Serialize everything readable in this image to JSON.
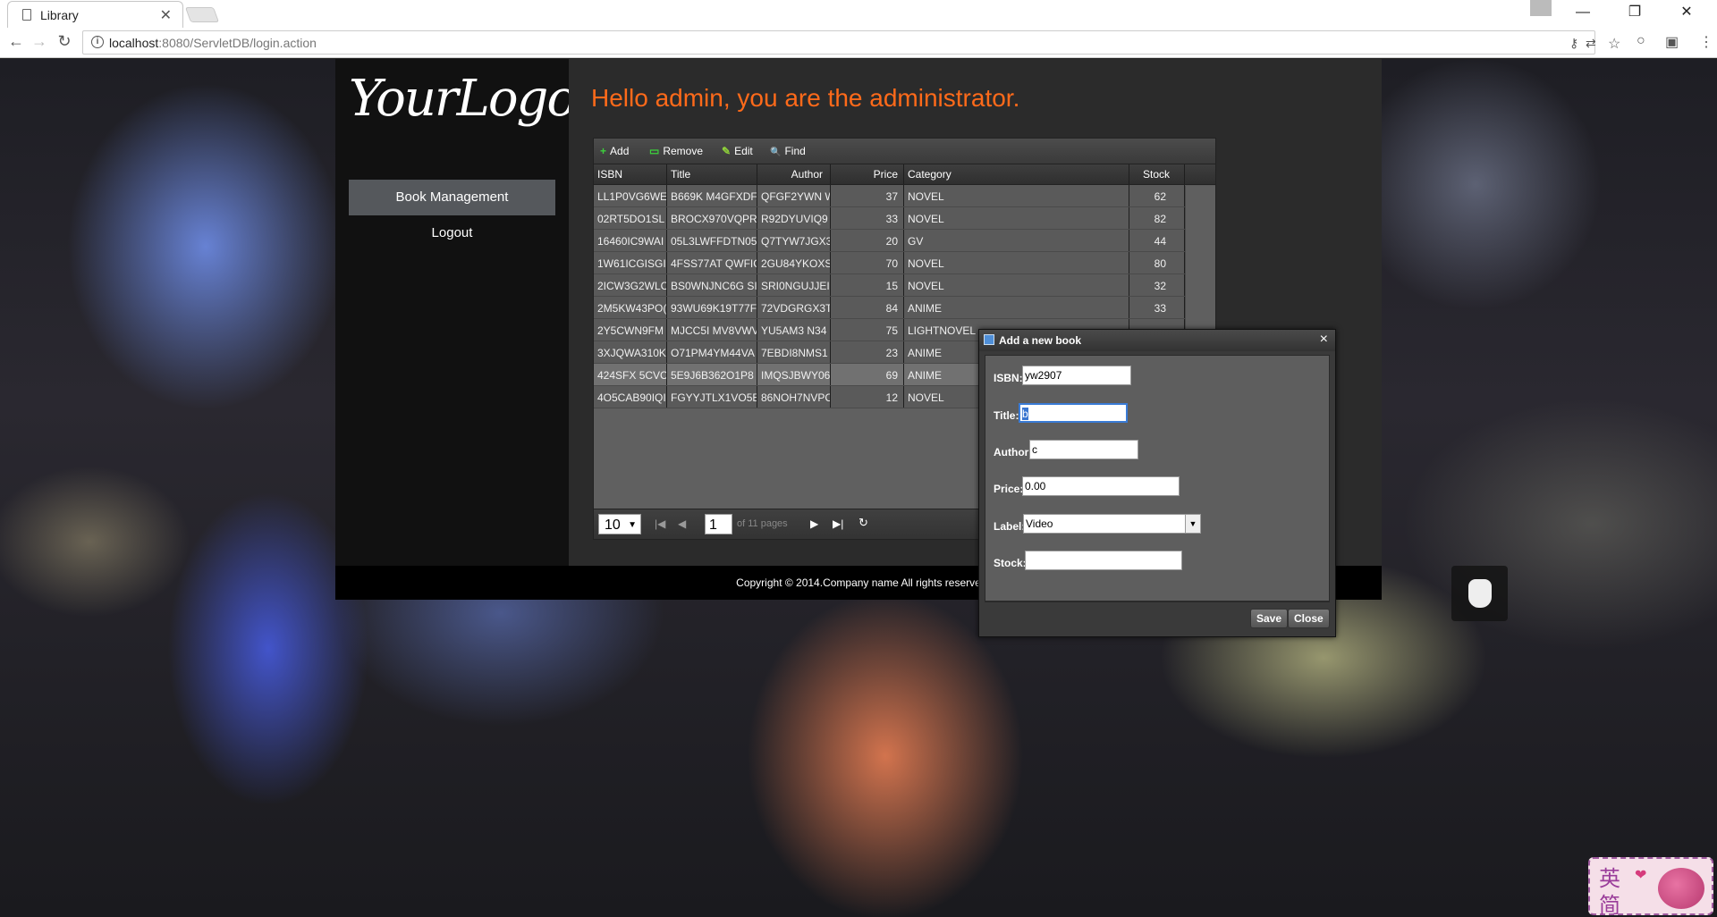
{
  "browser": {
    "tab_title": "Library",
    "tab_close": "✕",
    "url_host": "localhost",
    "url_rest": ":8080/ServletDB/login.action",
    "win_minimize": "—",
    "win_restore": "❐",
    "win_close": "✕",
    "back": "←",
    "forward": "→",
    "reload": "↻",
    "info_icon": "i",
    "key_icon": "⚷",
    "translate_icon": "⇄",
    "star_icon": "☆",
    "ext1_icon": "○",
    "ext2_icon": "▣",
    "menu_icon": "⋮"
  },
  "sidebar": {
    "logo": "YourLogo",
    "items": [
      {
        "label": "Book Management",
        "active": true
      },
      {
        "label": "Logout",
        "active": false
      }
    ]
  },
  "main": {
    "greeting": "Hello admin, you are the administrator."
  },
  "grid": {
    "toolbar": [
      {
        "label": "Add",
        "icon": "plus-icon",
        "glyph": "+",
        "color": "#3cd03c"
      },
      {
        "label": "Remove",
        "icon": "minus-icon",
        "glyph": "▭",
        "color": "#3cd03c"
      },
      {
        "label": "Edit",
        "icon": "pencil-icon",
        "glyph": "✎",
        "color": "#8fd13a"
      },
      {
        "label": "Find",
        "icon": "search-icon",
        "glyph": "🔍",
        "color": "#8ab4ff"
      }
    ],
    "columns": [
      "ISBN",
      "Title",
      "Author",
      "Price",
      "Category",
      "Stock"
    ],
    "rows": [
      [
        "LL1P0VG6WE",
        "B669K M4GFXDF",
        "QFGF2YWN W",
        "37",
        "NOVEL",
        "62"
      ],
      [
        "02RT5DO1SL",
        "BROCX970VQPR",
        "R92DYUVIQ9",
        "33",
        "NOVEL",
        "82"
      ],
      [
        "16460IC9WAI",
        "05L3LWFFDTN05",
        "Q7TYW7JGX3",
        "20",
        "GV",
        "44"
      ],
      [
        "1W61ICGISGI",
        "4FSS77AT QWFIC",
        "2GU84YKOXS",
        "70",
        "NOVEL",
        "80"
      ],
      [
        "2ICW3G2WLC",
        "BS0WNJNC6G SI",
        "SRI0NGUJJEI",
        "15",
        "NOVEL",
        "32"
      ],
      [
        "2M5KW43PO(",
        "93WU69K19T77F",
        "72VDGRGX3T",
        "84",
        "ANIME",
        "33"
      ],
      [
        "2Y5CWN9FM",
        "MJCC5I MV8VWV",
        "YU5AM3 N34",
        "75",
        "LIGHTNOVEL",
        ""
      ],
      [
        "3XJQWA310K",
        "O71PM4YM44VA",
        "7EBDI8NMS1",
        "23",
        "ANIME",
        ""
      ],
      [
        "424SFX 5CVC",
        "5E9J6B362O1P8",
        "IMQSJBWY06",
        "69",
        "ANIME",
        ""
      ],
      [
        "4O5CAB90IQI",
        "FGYYJTLX1VO5E",
        "86NOH7NVPC",
        "12",
        "NOVEL",
        ""
      ]
    ],
    "selected_row": 8,
    "pager": {
      "page_size": "10",
      "page_size_arrow": "▼",
      "current_page": "1",
      "of_pages": "of 11 pages",
      "first": "|◀",
      "prev": "◀",
      "next": "▶",
      "last": "▶|",
      "refresh": "↻"
    }
  },
  "footer": {
    "copyright": "Copyright © 2014.Company name All rights reserve"
  },
  "dialog": {
    "title": "Add a new book",
    "close": "×",
    "fields": {
      "isbn_label": "ISBN:",
      "isbn_value": "yw2907",
      "title_label": "Title:",
      "title_value": "b",
      "author_label": "Author:",
      "author_value": "c",
      "price_label": "Price:",
      "price_value": "0.00",
      "label_label": "Label:",
      "label_value": "Video",
      "stock_label": "Stock:",
      "stock_value": ""
    },
    "save_label": "Save",
    "close_label": "Close"
  },
  "ime": {
    "char1": "英",
    "char2": "简",
    "heart": "❤"
  },
  "colors": {
    "greeting": "#ff6a1a",
    "selected_row": "#717171",
    "focus_border": "#3a7bd5"
  }
}
